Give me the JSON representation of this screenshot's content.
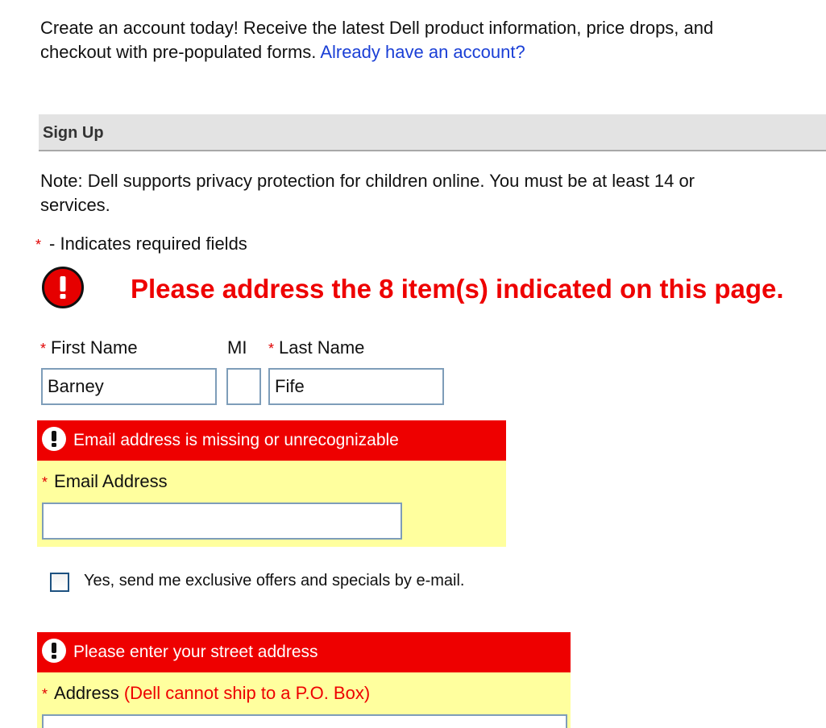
{
  "intro": {
    "text_line1": "Create an account today! Receive the latest Dell product information, price drops, and",
    "text_line2": "checkout with pre-populated forms.",
    "signin_link": "Already have an account?"
  },
  "section": {
    "title": "Sign Up"
  },
  "note": {
    "line1": "Note: Dell supports privacy protection for children online. You must be at least 14 or",
    "line2": "services."
  },
  "required_legend": {
    "star": "*",
    "text": "- Indicates required fields"
  },
  "summary_alert": {
    "message": "Please address the 8 item(s) indicated on this page."
  },
  "name_fields": {
    "first_label": "First Name",
    "mi_label": "MI",
    "last_label": "Last Name",
    "first_value": "Barney",
    "mi_value": "",
    "last_value": "Fife"
  },
  "email": {
    "error": "Email address is missing or unrecognizable",
    "label": "Email Address",
    "value": ""
  },
  "offers_checkbox": {
    "label": "Yes, send me exclusive offers and specials by e-mail.",
    "checked": false
  },
  "address": {
    "error": "Please enter your street address",
    "label": "Address",
    "note": "(Dell cannot ship to a P.O. Box)",
    "value": ""
  },
  "colors": {
    "error_red": "#ee0000",
    "highlight_yellow": "#ffff9e",
    "link_blue": "#1a3fd6",
    "input_border": "#7e9db9"
  }
}
